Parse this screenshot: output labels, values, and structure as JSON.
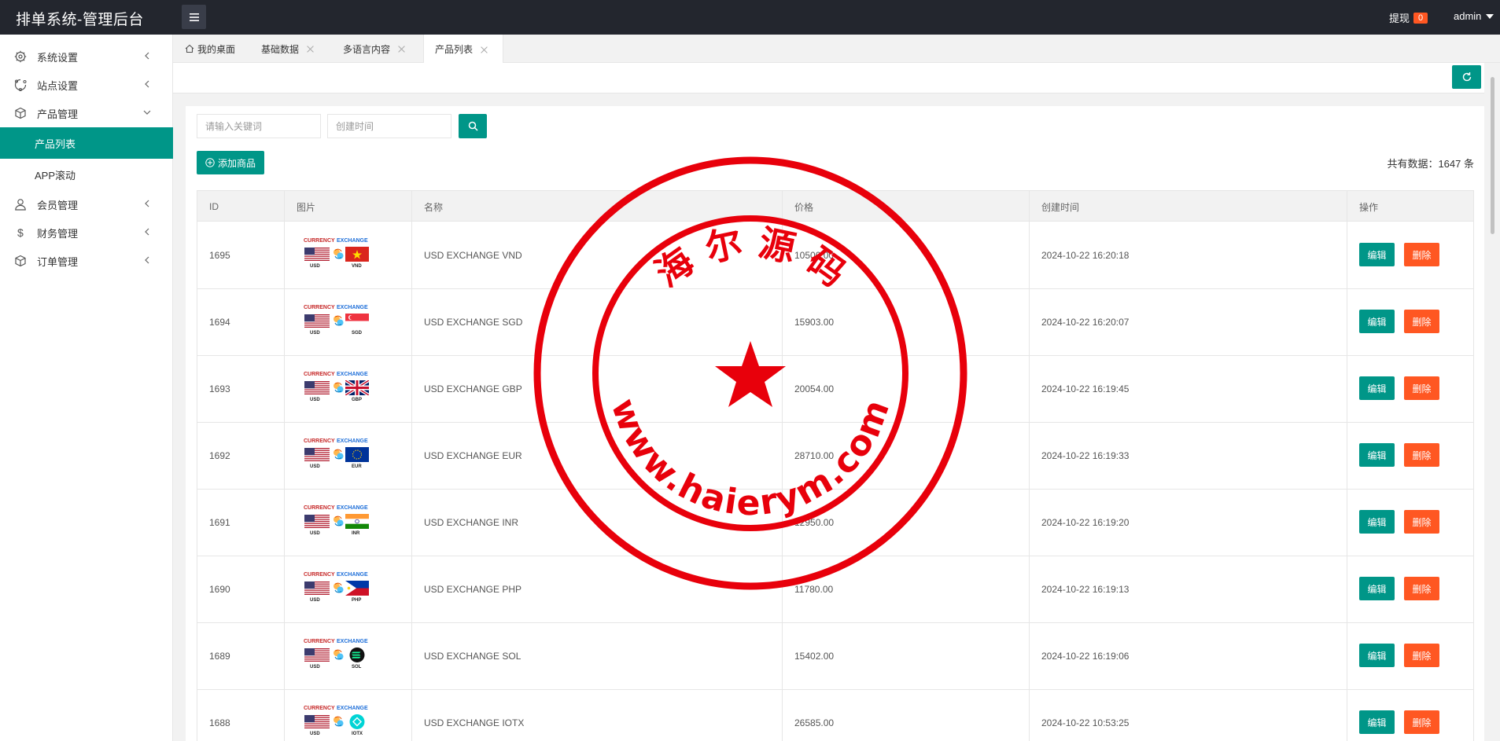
{
  "header": {
    "title": "排单系统-管理后台",
    "withdraw_label": "提现",
    "withdraw_count": "0",
    "user": "admin"
  },
  "sidebar": {
    "items": [
      {
        "label": "系统设置",
        "icon": "gear-icon"
      },
      {
        "label": "站点设置",
        "icon": "site-icon"
      },
      {
        "label": "产品管理",
        "icon": "box-icon",
        "expanded": true
      },
      {
        "label": "会员管理",
        "icon": "user-icon"
      },
      {
        "label": "财务管理",
        "icon": "dollar-icon"
      },
      {
        "label": "订单管理",
        "icon": "box-icon"
      }
    ],
    "sub_items": [
      {
        "label": "产品列表",
        "active": true
      },
      {
        "label": "APP滚动"
      }
    ]
  },
  "tabs": [
    {
      "label": "我的桌面"
    },
    {
      "label": "基础数据"
    },
    {
      "label": "多语言内容"
    },
    {
      "label": "产品列表",
      "active": true
    }
  ],
  "search": {
    "keyword_placeholder": "请输入关键词",
    "date_placeholder": "创建时间"
  },
  "actions": {
    "add_label": "添加商品",
    "total_text": "共有数据：1647 条"
  },
  "table": {
    "headers": [
      "ID",
      "图片",
      "名称",
      "价格",
      "创建时间",
      "操作"
    ],
    "rows": [
      {
        "id": "1695",
        "img_top_left": "CURRENCY",
        "img_top_right": "EXCHANGE",
        "from": "USD",
        "to": "VND",
        "name": "USD EXCHANGE VND",
        "price": "10500.00",
        "time": "2024-10-22 16:20:18"
      },
      {
        "id": "1694",
        "img_top_left": "CURRENCY",
        "img_top_right": "EXCHANGE",
        "from": "USD",
        "to": "SGD",
        "name": "USD EXCHANGE SGD",
        "price": "15903.00",
        "time": "2024-10-22 16:20:07"
      },
      {
        "id": "1693",
        "img_top_left": "CURRENCY",
        "img_top_right": "EXCHANGE",
        "from": "USD",
        "to": "GBP",
        "name": "USD EXCHANGE GBP",
        "price": "20054.00",
        "time": "2024-10-22 16:19:45"
      },
      {
        "id": "1692",
        "img_top_left": "CURRENCY",
        "img_top_right": "EXCHANGE",
        "from": "USD",
        "to": "EUR",
        "name": "USD EXCHANGE EUR",
        "price": "28710.00",
        "time": "2024-10-22 16:19:33"
      },
      {
        "id": "1691",
        "img_top_left": "CURRENCY",
        "img_top_right": "EXCHANGE",
        "from": "USD",
        "to": "INR",
        "name": "USD EXCHANGE INR",
        "price": "12950.00",
        "time": "2024-10-22 16:19:20"
      },
      {
        "id": "1690",
        "img_top_left": "CURRENCY",
        "img_top_right": "EXCHANGE",
        "from": "USD",
        "to": "PHP",
        "name": "USD EXCHANGE PHP",
        "price": "11780.00",
        "time": "2024-10-22 16:19:13"
      },
      {
        "id": "1689",
        "img_top_left": "CURRENCY",
        "img_top_right": "EXCHANGE",
        "from": "USD",
        "to": "SOL",
        "name": "USD EXCHANGE SOL",
        "price": "15402.00",
        "time": "2024-10-22 16:19:06"
      },
      {
        "id": "1688",
        "img_top_left": "CURRENCY",
        "img_top_right": "EXCHANGE",
        "from": "USD",
        "to": "IOTX",
        "name": "USD EXCHANGE IOTX",
        "price": "26585.00",
        "time": "2024-10-22 10:53:25"
      }
    ],
    "edit_label": "编辑",
    "delete_label": "删除"
  },
  "watermark": {
    "top_text": "海 尔 源 码",
    "bottom_text": "www.haierym.com"
  },
  "colors": {
    "accent": "#009688",
    "danger": "#ff5722",
    "header_bg": "#23262e",
    "stamp_red": "#e8000b"
  }
}
